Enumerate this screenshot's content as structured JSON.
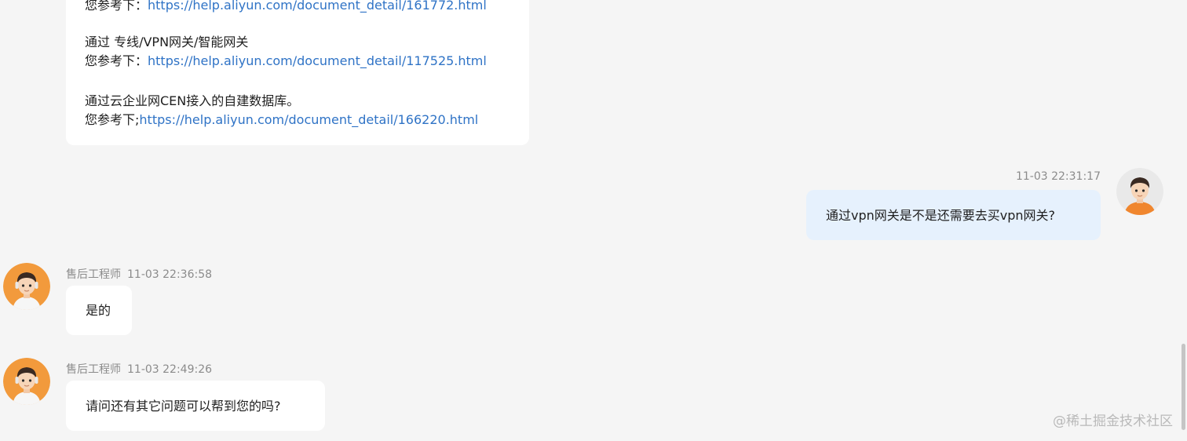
{
  "messages": {
    "m1": {
      "lines": [
        {
          "prefix": "您参考下：",
          "link": "https://help.aliyun.com/document_detail/161772.html"
        },
        {
          "text": "通过 专线/VPN网关/智能网关"
        },
        {
          "prefix": "您参考下：",
          "link": "https://help.aliyun.com/document_detail/117525.html"
        },
        {
          "text": "通过云企业网CEN接入的自建数据库。"
        },
        {
          "prefix": "您参考下;",
          "link": "https://help.aliyun.com/document_detail/166220.html"
        }
      ]
    },
    "m2": {
      "time": "11-03 22:31:17",
      "text": "通过vpn网关是不是还需要去买vpn网关?"
    },
    "m3": {
      "sender": "售后工程师",
      "time": "11-03 22:36:58",
      "text": "是的"
    },
    "m4": {
      "sender": "售后工程师",
      "time": "11-03 22:49:26",
      "text": "请问还有其它问题可以帮到您的吗?"
    }
  },
  "watermark": "@稀土掘金技术社区",
  "colors": {
    "background": "#f5f5f5",
    "agent_bubble": "#ffffff",
    "user_bubble": "#e6f1fd",
    "link": "#2f73c6",
    "meta_text": "#8b8b8b",
    "avatar_orange": "#f29a3c"
  },
  "icons": {
    "user_avatar": "user-avatar-icon",
    "agent_avatar": "agent-avatar-icon"
  }
}
